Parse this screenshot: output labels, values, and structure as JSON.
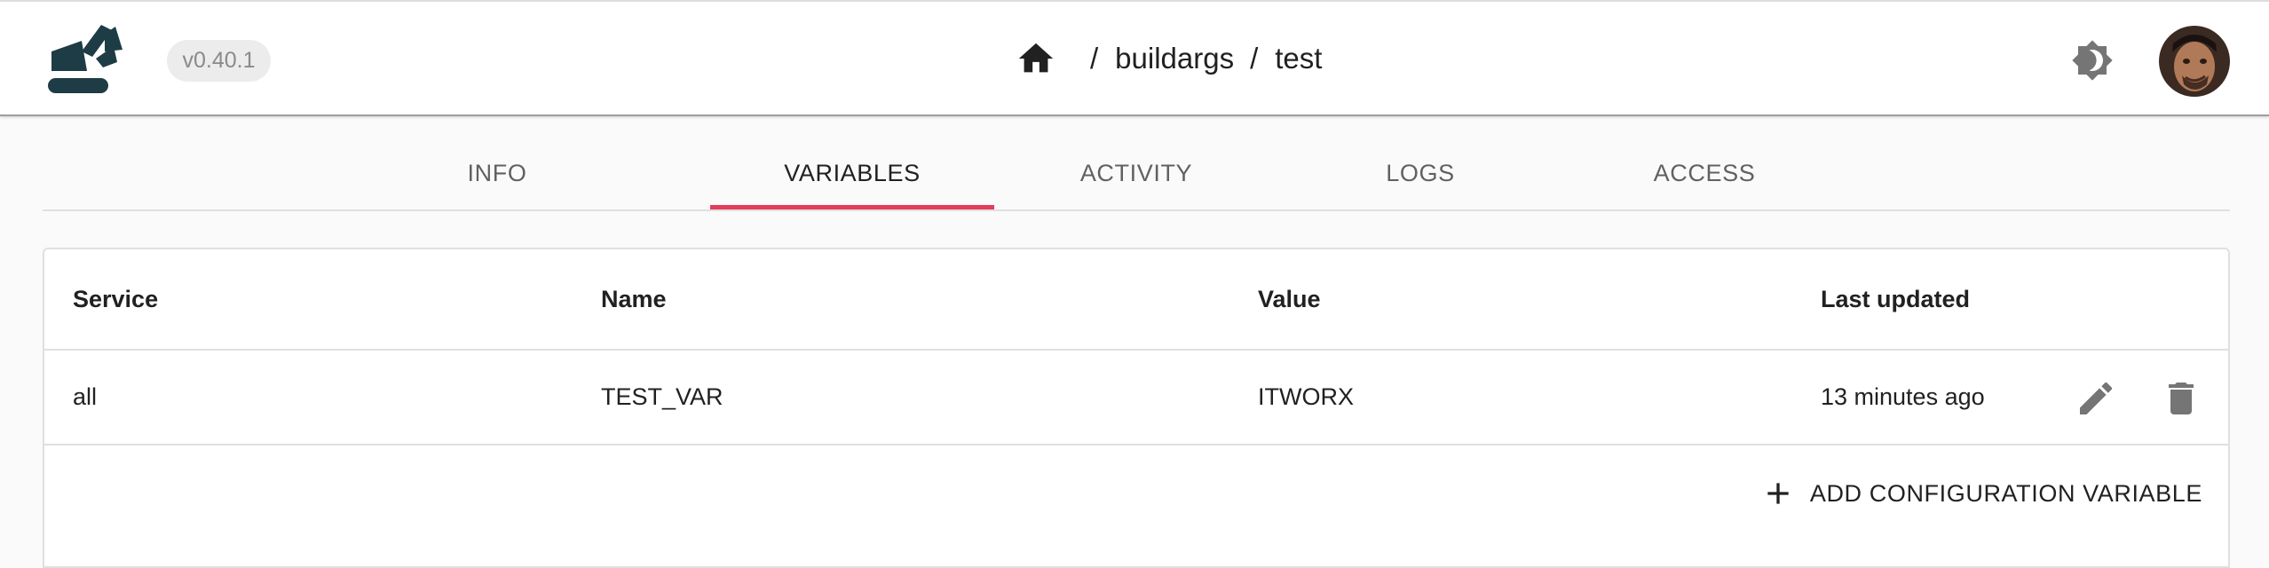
{
  "header": {
    "logo_icon": "excavator-logo-icon",
    "version": "v0.40.1",
    "breadcrumb": {
      "home_icon": "home-icon",
      "separator": "/",
      "items": [
        "buildargs",
        "test"
      ]
    },
    "theme_toggle_icon": "brightness-icon",
    "avatar_icon": "user-avatar"
  },
  "tabs": [
    {
      "label": "INFO",
      "active": false
    },
    {
      "label": "VARIABLES",
      "active": true
    },
    {
      "label": "ACTIVITY",
      "active": false
    },
    {
      "label": "LOGS",
      "active": false
    },
    {
      "label": "ACCESS",
      "active": false
    }
  ],
  "table": {
    "columns": [
      "Service",
      "Name",
      "Value",
      "Last updated"
    ],
    "rows": [
      {
        "service": "all",
        "name": "TEST_VAR",
        "value": "ITWORX",
        "last_updated": "13 minutes ago"
      }
    ],
    "row_actions": [
      "edit-icon",
      "delete-icon"
    ]
  },
  "add_button": {
    "icon": "plus-icon",
    "label": "ADD CONFIGURATION VARIABLE"
  },
  "colors": {
    "accent": "#e33c5c",
    "logo": "#1e3c45",
    "header_bg": "#ffffff",
    "page_bg": "#fafafa",
    "icon_gray": "#757575"
  }
}
